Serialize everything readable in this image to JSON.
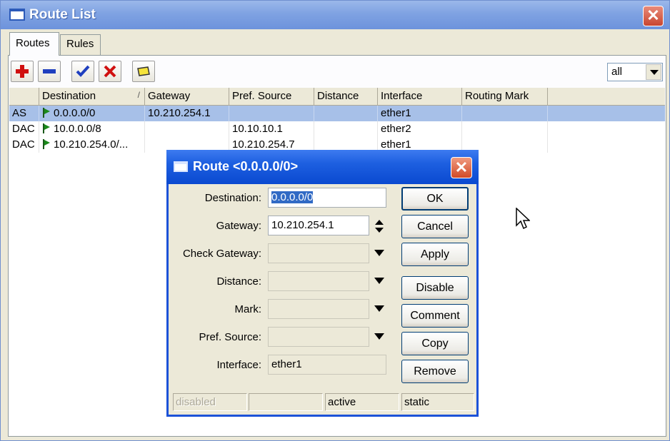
{
  "window": {
    "title": "Route List",
    "close": "✕"
  },
  "tabs": [
    {
      "label": "Routes"
    },
    {
      "label": "Rules"
    }
  ],
  "filter": {
    "value": "all"
  },
  "table": {
    "columns": [
      "",
      "Destination",
      "Gateway",
      "Pref. Source",
      "Distance",
      "Interface",
      "Routing Mark"
    ],
    "sort_indicator": "/",
    "rows": [
      {
        "flags": "AS",
        "destination": "0.0.0.0/0",
        "gateway": "10.210.254.1",
        "pref_source": "",
        "distance": "",
        "interface": "ether1",
        "routing_mark": ""
      },
      {
        "flags": "DAC",
        "destination": "10.0.0.0/8",
        "gateway": "",
        "pref_source": "10.10.10.1",
        "distance": "",
        "interface": "ether2",
        "routing_mark": ""
      },
      {
        "flags": "DAC",
        "destination": "10.210.254.0/...",
        "gateway": "",
        "pref_source": "10.210.254.7",
        "distance": "",
        "interface": "ether1",
        "routing_mark": ""
      }
    ]
  },
  "dialog": {
    "title": "Route <0.0.0.0/0>",
    "close": "✕",
    "fields": {
      "destination": {
        "label": "Destination:",
        "value": "0.0.0.0/0"
      },
      "gateway": {
        "label": "Gateway:",
        "value": "10.210.254.1"
      },
      "check_gateway": {
        "label": "Check Gateway:",
        "value": ""
      },
      "distance": {
        "label": "Distance:",
        "value": ""
      },
      "mark": {
        "label": "Mark:",
        "value": ""
      },
      "pref_source": {
        "label": "Pref. Source:",
        "value": ""
      },
      "interface": {
        "label": "Interface:",
        "value": "ether1"
      }
    },
    "buttons": {
      "ok": "OK",
      "cancel": "Cancel",
      "apply": "Apply",
      "disable": "Disable",
      "comment": "Comment",
      "copy": "Copy",
      "remove": "Remove"
    },
    "status": {
      "disabled": "disabled",
      "empty": "",
      "active": "active",
      "static": "static"
    }
  },
  "colors": {
    "selection": "#a7c0e8",
    "dialog_titlebar": "#1d5fe0",
    "main_titlebar": "#7fa2e2",
    "route_flag": "#1a8a1a",
    "add": "#d01010",
    "enable": "#1f3fbf",
    "disable": "#d01010"
  }
}
